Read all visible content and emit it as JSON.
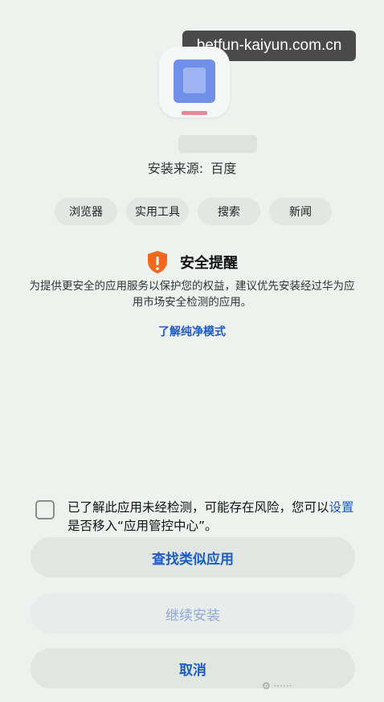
{
  "banner": {
    "url": "betfun-kaiyun.com.cn"
  },
  "app": {
    "source_label": "安装来源:",
    "source_value": "百度"
  },
  "tags": [
    "浏览器",
    "实用工具",
    "搜索",
    "新闻"
  ],
  "alert": {
    "title": "安全提醒",
    "description": "为提供更安全的应用服务以保护您的权益，建议优先安装经过华为应用市场安全检测的应用。",
    "learn_more": "了解纯净模式"
  },
  "consent": {
    "text_before": "已了解此应用未经检测，可能存在风险，您可以",
    "link": "设置",
    "text_after": "是否移入“应用管控中心”。"
  },
  "buttons": {
    "find_similar": "查找类似应用",
    "continue_install": "继续安装",
    "cancel": "取消"
  },
  "colors": {
    "accent": "#1a5bc4",
    "warning": "#ef6a1f",
    "background": "#eef2ef"
  }
}
